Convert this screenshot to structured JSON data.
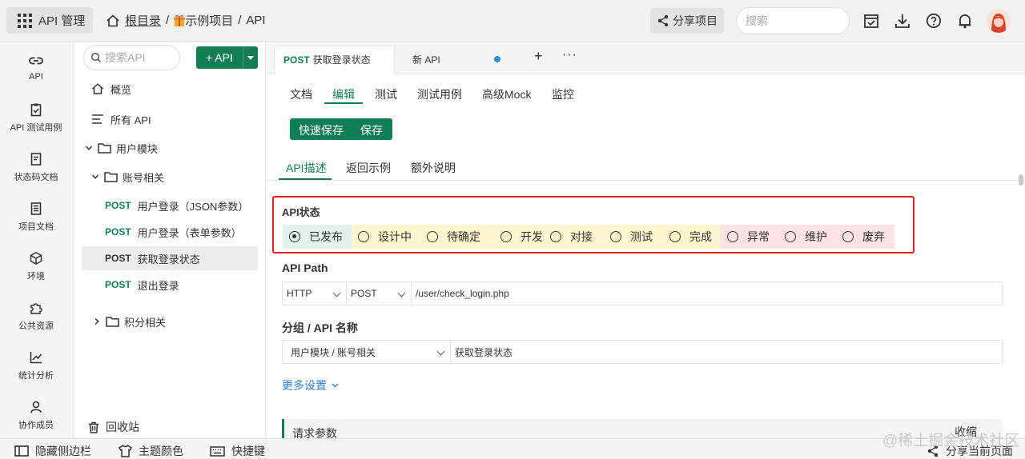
{
  "topbar": {
    "app_menu": "API 管理",
    "breadcrumb": {
      "root": "根目录",
      "sep1": "/",
      "project": "示例项目",
      "sep2": "/",
      "section": "API"
    },
    "share_button": "分享项目",
    "search_placeholder": "搜索"
  },
  "rail": {
    "items": [
      {
        "label": "API",
        "icon": "link-icon"
      },
      {
        "label": "API 测试用例",
        "icon": "clipboard-icon"
      },
      {
        "label": "状态码文档",
        "icon": "document-icon"
      },
      {
        "label": "项目文档",
        "icon": "notes-icon"
      },
      {
        "label": "环境",
        "icon": "cube-icon"
      },
      {
        "label": "公共资源",
        "icon": "puzzle-icon"
      },
      {
        "label": "统计分析",
        "icon": "chart-icon"
      },
      {
        "label": "协作成员",
        "icon": "user-icon"
      }
    ]
  },
  "tree": {
    "search_placeholder": "搜索API",
    "add_button": "+ API",
    "overview": "概览",
    "all_api": "所有 API",
    "folder_user": "用户模块",
    "folder_account": "账号相关",
    "apis": [
      {
        "method": "POST",
        "name": "用户登录（JSON参数）"
      },
      {
        "method": "POST",
        "name": "用户登录（表单参数）"
      },
      {
        "method": "POST",
        "name": "获取登录状态"
      },
      {
        "method": "POST",
        "name": "退出登录"
      }
    ],
    "folder_points": "积分相关",
    "recycle": "回收站"
  },
  "tabs": {
    "active_method": "POST",
    "active_name": "获取登录状态",
    "second": "新 API",
    "add": "+",
    "more": "···"
  },
  "subtabs": [
    "文档",
    "编辑",
    "测试",
    "测试用例",
    "高级Mock",
    "监控"
  ],
  "save": {
    "quick": "快速保存",
    "save": "保存"
  },
  "section_tabs": [
    "API描述",
    "返回示例",
    "额外说明"
  ],
  "status": {
    "label": "API状态",
    "options": [
      "已发布",
      "设计中",
      "待确定",
      "开发",
      "对接",
      "测试",
      "完成",
      "异常",
      "维护",
      "废弃"
    ],
    "selected": "已发布",
    "colors": {
      "published": "#e1f1ee",
      "in_progress": "#fff6cf",
      "problem": "#fde3e5"
    }
  },
  "api_path": {
    "label": "API Path",
    "protocol": "HTTP",
    "method": "POST",
    "path": "/user/check_login.php"
  },
  "group_name": {
    "label": "分组 / API 名称",
    "group": "用户模块 / 账号相关",
    "name": "获取登录状态"
  },
  "more_settings": "更多设置",
  "request_params": {
    "label": "请求参数",
    "collapse": "收缩"
  },
  "bottombar": {
    "hide_sidebar": "隐藏侧边栏",
    "theme": "主题颜色",
    "shortcuts": "快捷键",
    "share_page": "分享当前页面"
  },
  "watermark": "@稀土掘金技术社区",
  "colors": {
    "brand_green": "#117d55",
    "link_blue": "#2f7fd6",
    "highlight_red": "#e02020"
  }
}
